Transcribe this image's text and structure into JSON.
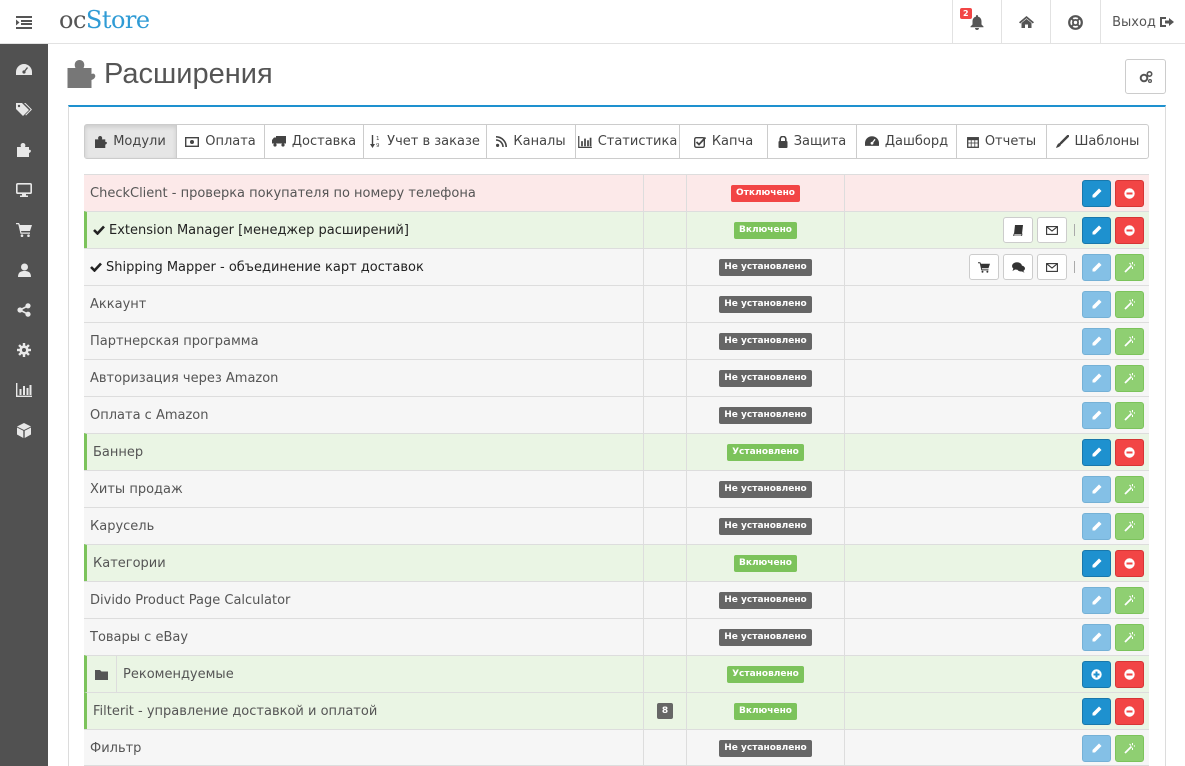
{
  "header": {
    "logo_oc": "oc",
    "logo_store": "Store",
    "notification_count": "2",
    "logout_label": "Выход"
  },
  "sidebar": {
    "items": [
      "dashboard-icon",
      "tags-icon",
      "puzzle-icon",
      "desktop-icon",
      "cart-icon",
      "user-icon",
      "share-icon",
      "cog-icon",
      "bar-chart-icon",
      "cube-icon"
    ]
  },
  "page": {
    "title": "Расширения"
  },
  "tabs": [
    {
      "label": "Модули",
      "icon": "puzzle-icon",
      "active": true
    },
    {
      "label": "Оплата",
      "icon": "money-icon"
    },
    {
      "label": "Доставка",
      "icon": "truck-icon"
    },
    {
      "label": "Учет в заказе",
      "icon": "sort-icon"
    },
    {
      "label": "Каналы",
      "icon": "rss-icon"
    },
    {
      "label": "Статистика",
      "icon": "chart-icon"
    },
    {
      "label": "Капча",
      "icon": "check-square-icon"
    },
    {
      "label": "Защита",
      "icon": "lock-icon"
    },
    {
      "label": "Дашборд",
      "icon": "dashboard-icon"
    },
    {
      "label": "Отчеты",
      "icon": "calendar-icon"
    },
    {
      "label": "Шаблоны",
      "icon": "brush-icon"
    }
  ],
  "status_colors": {
    "disabled": "#f24545",
    "enabled": "#7cc35b",
    "not_installed": "#666666",
    "primary": "#1e91cf"
  },
  "rows": [
    {
      "name": "CheckClient - проверка покупателя по номеру телефона",
      "status": "Отключено",
      "status_type": "red",
      "row_type": "red",
      "actions": [
        "edit",
        "uninstall"
      ]
    },
    {
      "name": "Extension Manager [менеджер расширений]",
      "status": "Включено",
      "status_type": "green",
      "row_type": "green",
      "checked": true,
      "extra": [
        "book",
        "mail"
      ],
      "actions": [
        "edit",
        "uninstall"
      ]
    },
    {
      "name": "Shipping Mapper - объединение карт доставок",
      "status": "Не установлено",
      "status_type": "grey",
      "row_type": "plain",
      "checked": true,
      "extra": [
        "cart",
        "comments",
        "mail"
      ],
      "actions": [
        "edit-lt",
        "install"
      ]
    },
    {
      "name": "Аккаунт",
      "status": "Не установлено",
      "status_type": "grey",
      "row_type": "plain",
      "actions": [
        "edit-lt",
        "install"
      ]
    },
    {
      "name": "Партнерская программа",
      "status": "Не установлено",
      "status_type": "grey",
      "row_type": "plain",
      "actions": [
        "edit-lt",
        "install"
      ]
    },
    {
      "name": "Авторизация через Amazon",
      "status": "Не установлено",
      "status_type": "grey",
      "row_type": "plain",
      "actions": [
        "edit-lt",
        "install"
      ]
    },
    {
      "name": "Оплата с Amazon",
      "status": "Не установлено",
      "status_type": "grey",
      "row_type": "plain",
      "actions": [
        "edit-lt",
        "install"
      ]
    },
    {
      "name": "Баннер",
      "status": "Установлено",
      "status_type": "green",
      "row_type": "green",
      "actions": [
        "edit",
        "uninstall"
      ]
    },
    {
      "name": "Хиты продаж",
      "status": "Не установлено",
      "status_type": "grey",
      "row_type": "plain",
      "actions": [
        "edit-lt",
        "install"
      ]
    },
    {
      "name": "Карусель",
      "status": "Не установлено",
      "status_type": "grey",
      "row_type": "plain",
      "actions": [
        "edit-lt",
        "install"
      ]
    },
    {
      "name": "Категории",
      "status": "Включено",
      "status_type": "green",
      "row_type": "green",
      "actions": [
        "edit",
        "uninstall"
      ]
    },
    {
      "name": "Divido Product Page Calculator",
      "status": "Не установлено",
      "status_type": "grey",
      "row_type": "plain",
      "actions": [
        "edit-lt",
        "install"
      ]
    },
    {
      "name": "Товары с eBay",
      "status": "Не установлено",
      "status_type": "grey",
      "row_type": "plain",
      "actions": [
        "edit-lt",
        "install"
      ]
    },
    {
      "name": "Рекомендуемые",
      "status": "Установлено",
      "status_type": "green",
      "row_type": "green",
      "folder": true,
      "actions": [
        "add",
        "uninstall"
      ]
    },
    {
      "name": "Filterit - управление доставкой и оплатой",
      "status": "Включено",
      "status_type": "green",
      "row_type": "green",
      "count": "8",
      "actions": [
        "edit",
        "uninstall"
      ]
    },
    {
      "name": "Фильтр",
      "status": "Не установлено",
      "status_type": "grey",
      "row_type": "plain",
      "actions": [
        "edit-lt",
        "install"
      ]
    }
  ]
}
